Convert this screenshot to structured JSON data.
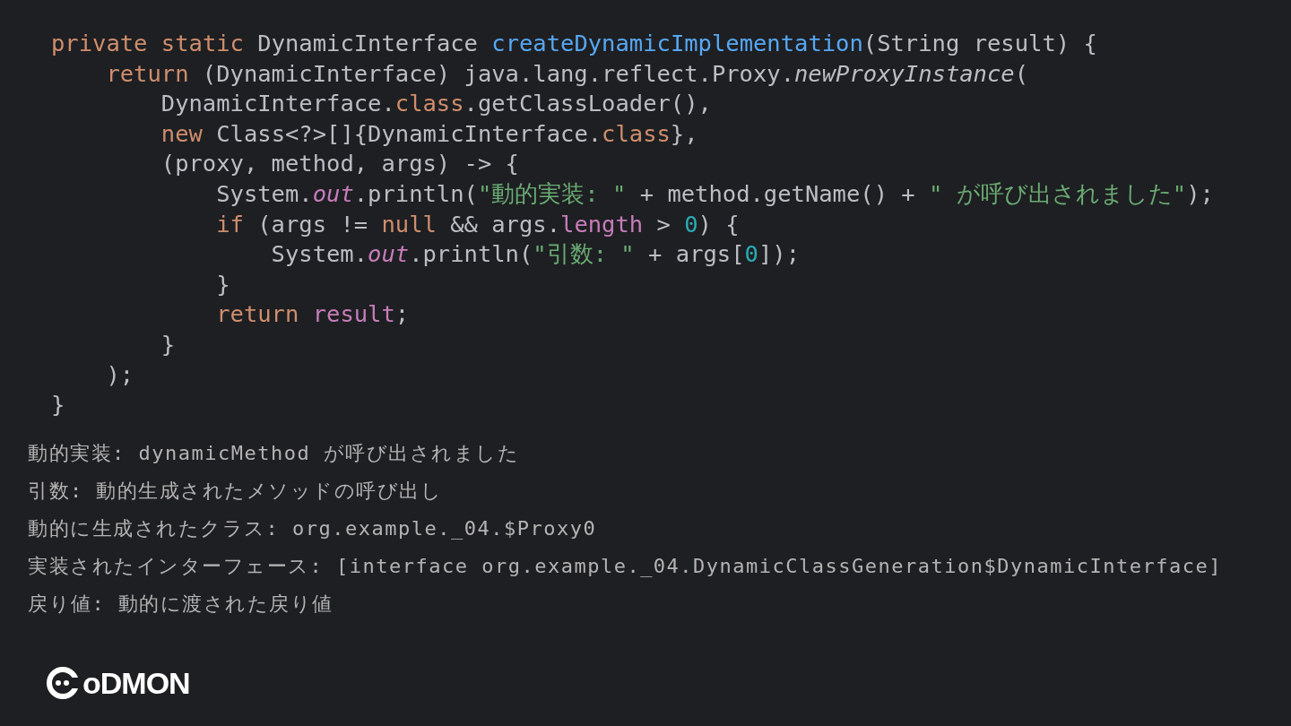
{
  "code_lines": [
    [
      {
        "kind": "keyword",
        "text": "private static "
      },
      {
        "kind": "plain",
        "text": "DynamicInterface "
      },
      {
        "kind": "method",
        "text": "createDynamicImplementation"
      },
      {
        "kind": "plain",
        "text": "(String result) {"
      }
    ],
    [
      {
        "kind": "keyword",
        "text": "    return "
      },
      {
        "kind": "plain",
        "text": "(DynamicInterface) java.lang.reflect.Proxy."
      },
      {
        "kind": "static_call",
        "text": "newProxyInstance"
      },
      {
        "kind": "plain",
        "text": "("
      }
    ],
    [
      {
        "kind": "plain",
        "text": "        DynamicInterface."
      },
      {
        "kind": "keyword",
        "text": "class"
      },
      {
        "kind": "plain",
        "text": ".getClassLoader(),"
      }
    ],
    [
      {
        "kind": "keyword",
        "text": "        new "
      },
      {
        "kind": "plain",
        "text": "Class<?>[]{DynamicInterface."
      },
      {
        "kind": "keyword",
        "text": "class"
      },
      {
        "kind": "plain",
        "text": "},"
      }
    ],
    [
      {
        "kind": "plain",
        "text": "        (proxy, method, args) -> {"
      }
    ],
    [
      {
        "kind": "plain",
        "text": "            System."
      },
      {
        "kind": "static_field",
        "text": "out"
      },
      {
        "kind": "plain",
        "text": ".println("
      },
      {
        "kind": "string",
        "text": "\"動的実装: \""
      },
      {
        "kind": "plain",
        "text": " + method.getName() + "
      },
      {
        "kind": "string",
        "text": "\" が呼び出されました\""
      },
      {
        "kind": "plain",
        "text": ");"
      }
    ],
    [
      {
        "kind": "keyword",
        "text": "            if "
      },
      {
        "kind": "plain",
        "text": "(args != "
      },
      {
        "kind": "keyword",
        "text": "null "
      },
      {
        "kind": "plain",
        "text": "&& args."
      },
      {
        "kind": "field",
        "text": "length"
      },
      {
        "kind": "plain",
        "text": " > "
      },
      {
        "kind": "number",
        "text": "0"
      },
      {
        "kind": "plain",
        "text": ") {"
      }
    ],
    [
      {
        "kind": "plain",
        "text": "                System."
      },
      {
        "kind": "static_field",
        "text": "out"
      },
      {
        "kind": "plain",
        "text": ".println("
      },
      {
        "kind": "string",
        "text": "\"引数: \""
      },
      {
        "kind": "plain",
        "text": " + args["
      },
      {
        "kind": "number",
        "text": "0"
      },
      {
        "kind": "plain",
        "text": "]);"
      }
    ],
    [
      {
        "kind": "plain",
        "text": "            }"
      }
    ],
    [
      {
        "kind": "keyword",
        "text": "            return "
      },
      {
        "kind": "field",
        "text": "result"
      },
      {
        "kind": "plain",
        "text": ";"
      }
    ],
    [
      {
        "kind": "plain",
        "text": "        }"
      }
    ],
    [
      {
        "kind": "plain",
        "text": "    );"
      }
    ],
    [
      {
        "kind": "plain",
        "text": "}"
      }
    ]
  ],
  "output_lines": [
    "動的実装: dynamicMethod が呼び出されました",
    "引数: 動的生成されたメソッドの呼び出し",
    "動的に生成されたクラス: org.example._04.$Proxy0",
    "実装されたインターフェース: [interface org.example._04.DynamicClassGeneration$DynamicInterface]",
    "戻り値: 動的に渡された戻り値"
  ],
  "logo": {
    "text": "oDMON"
  }
}
